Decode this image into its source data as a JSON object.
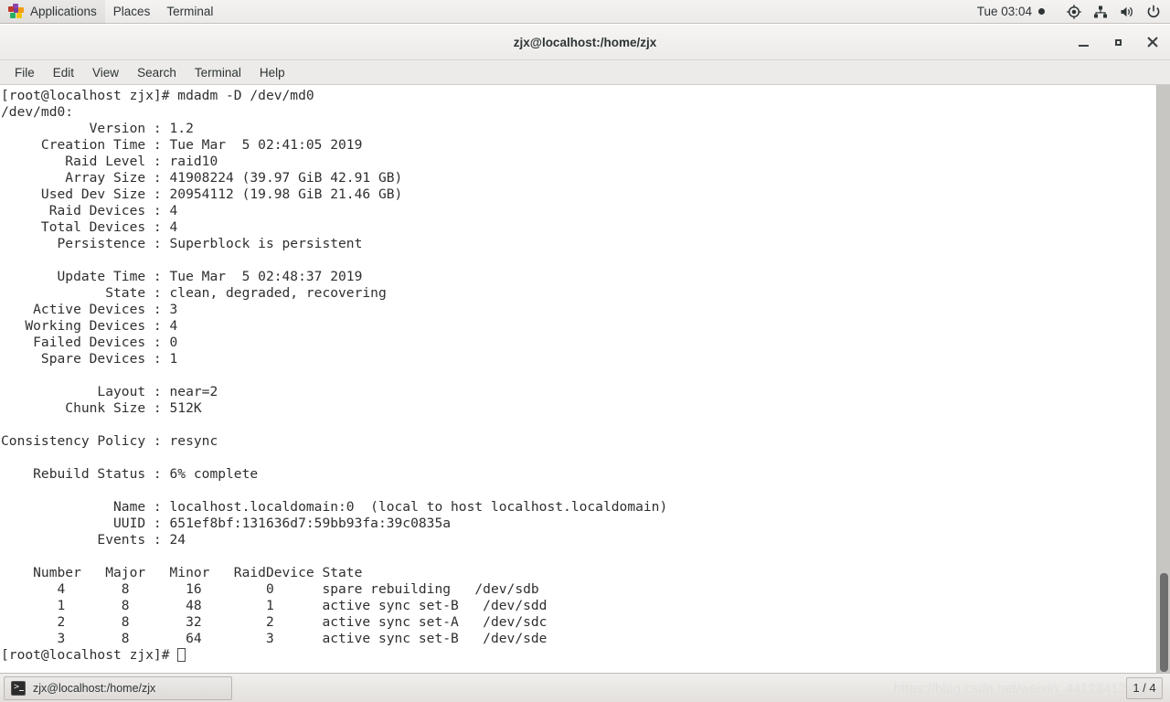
{
  "top_panel": {
    "apps_label": "Applications",
    "places_label": "Places",
    "terminal_label": "Terminal",
    "clock": "Tue 03:04",
    "tray": [
      {
        "name": "location-icon"
      },
      {
        "name": "network-icon"
      },
      {
        "name": "volume-icon"
      },
      {
        "name": "power-icon"
      }
    ]
  },
  "window": {
    "title": "zjx@localhost:/home/zjx",
    "buttons": {
      "minimize": "minimize",
      "maximize": "maximize",
      "close": "close"
    },
    "menubar": [
      {
        "label": "File"
      },
      {
        "label": "Edit"
      },
      {
        "label": "View"
      },
      {
        "label": "Search"
      },
      {
        "label": "Terminal"
      },
      {
        "label": "Help"
      }
    ]
  },
  "terminal": {
    "prompt": "[root@localhost zjx]# ",
    "command": "mdadm -D /dev/md0",
    "lines": [
      "[root@localhost zjx]# mdadm -D /dev/md0",
      "/dev/md0:",
      "           Version : 1.2",
      "     Creation Time : Tue Mar  5 02:41:05 2019",
      "        Raid Level : raid10",
      "        Array Size : 41908224 (39.97 GiB 42.91 GB)",
      "     Used Dev Size : 20954112 (19.98 GiB 21.46 GB)",
      "      Raid Devices : 4",
      "     Total Devices : 4",
      "       Persistence : Superblock is persistent",
      "",
      "       Update Time : Tue Mar  5 02:48:37 2019",
      "             State : clean, degraded, recovering",
      "    Active Devices : 3",
      "   Working Devices : 4",
      "    Failed Devices : 0",
      "     Spare Devices : 1",
      "",
      "            Layout : near=2",
      "        Chunk Size : 512K",
      "",
      "Consistency Policy : resync",
      "",
      "    Rebuild Status : 6% complete",
      "",
      "              Name : localhost.localdomain:0  (local to host localhost.localdomain)",
      "              UUID : 651ef8bf:131636d7:59bb93fa:39c0835a",
      "            Events : 24",
      "",
      "    Number   Major   Minor   RaidDevice State",
      "       4       8       16        0      spare rebuilding   /dev/sdb",
      "       1       8       48        1      active sync set-B   /dev/sdd",
      "       2       8       32        2      active sync set-A   /dev/sdc",
      "       3       8       64        3      active sync set-B   /dev/sde"
    ],
    "last_prompt": "[root@localhost zjx]# ",
    "details": {
      "device": "/dev/md0",
      "version": "1.2",
      "creation_time": "Tue Mar  5 02:41:05 2019",
      "raid_level": "raid10",
      "array_size": "41908224 (39.97 GiB 42.91 GB)",
      "used_dev_size": "20954112 (19.98 GiB 21.46 GB)",
      "raid_devices": "4",
      "total_devices": "4",
      "persistence": "Superblock is persistent",
      "update_time": "Tue Mar  5 02:48:37 2019",
      "state": "clean, degraded, recovering",
      "active_devices": "3",
      "working_devices": "4",
      "failed_devices": "0",
      "spare_devices": "1",
      "layout": "near=2",
      "chunk_size": "512K",
      "consistency_policy": "resync",
      "rebuild_status": "6% complete",
      "name": "localhost.localdomain:0  (local to host localhost.localdomain)",
      "uuid": "651ef8bf:131636d7:59bb93fa:39c0835a",
      "events": "24"
    },
    "device_table": {
      "headers": [
        "Number",
        "Major",
        "Minor",
        "RaidDevice",
        "State"
      ],
      "rows": [
        {
          "number": "4",
          "major": "8",
          "minor": "16",
          "raid_device": "0",
          "state": "spare rebuilding",
          "path": "/dev/sdb"
        },
        {
          "number": "1",
          "major": "8",
          "minor": "48",
          "raid_device": "1",
          "state": "active sync set-B",
          "path": "/dev/sdd"
        },
        {
          "number": "2",
          "major": "8",
          "minor": "32",
          "raid_device": "2",
          "state": "active sync set-A",
          "path": "/dev/sdc"
        },
        {
          "number": "3",
          "major": "8",
          "minor": "64",
          "raid_device": "3",
          "state": "active sync set-B",
          "path": "/dev/sde"
        }
      ]
    }
  },
  "bottom_panel": {
    "task_label": "zjx@localhost:/home/zjx",
    "task_icon": "terminal-icon",
    "workspace": "1 / 4",
    "watermark": "https://blog.csdn.net/weixin_44123412"
  },
  "colors": {
    "panel_bg": "#eceae8",
    "terminal_bg": "#ffffff",
    "terminal_fg": "#2f2f2f",
    "scrollbar_track": "#c8c6c3",
    "scrollbar_thumb": "#6e6e6e"
  }
}
